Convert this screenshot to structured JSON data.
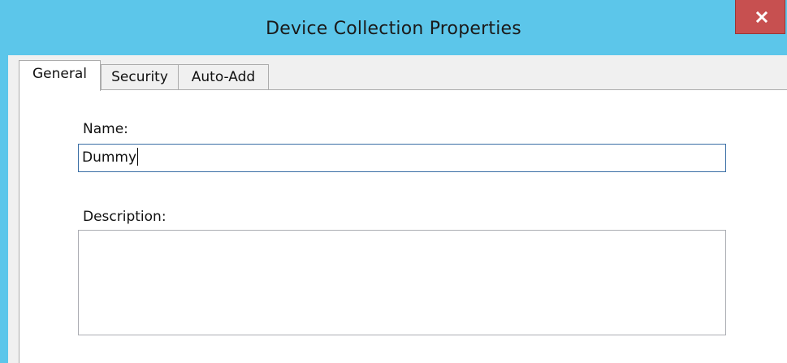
{
  "window": {
    "title": "Device Collection Properties",
    "close_icon": "close-icon"
  },
  "tabs": [
    {
      "label": "General",
      "active": true
    },
    {
      "label": "Security",
      "active": false
    },
    {
      "label": "Auto-Add",
      "active": false
    }
  ],
  "general": {
    "name_label": "Name:",
    "name_value": "Dummy",
    "description_label": "Description:",
    "description_value": ""
  },
  "colors": {
    "titlebar": "#5cc6ea",
    "close_button": "#c75050",
    "focus_border": "#3a6ea5"
  }
}
